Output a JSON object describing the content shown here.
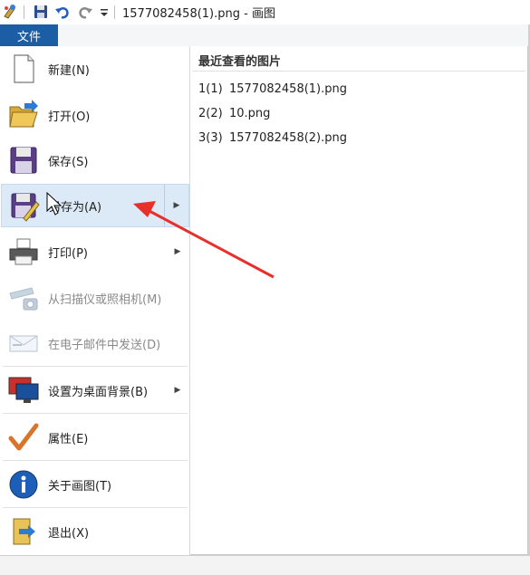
{
  "title_bar": {
    "title": "1577082458(1).png - 画图",
    "icons": [
      "paint-app-icon",
      "save-icon",
      "undo-icon",
      "redo-icon",
      "customize-quick-access-icon"
    ]
  },
  "ribbon": {
    "file_tab": "文件"
  },
  "menu": {
    "items": [
      {
        "label": "新建(N)",
        "icon": "new-document-icon",
        "enabled": true,
        "submenu": false
      },
      {
        "label": "打开(O)",
        "icon": "open-folder-icon",
        "enabled": true,
        "submenu": false
      },
      {
        "label": "保存(S)",
        "icon": "save-disk-icon",
        "enabled": true,
        "submenu": false
      },
      {
        "label": "另存为(A)",
        "icon": "save-as-icon",
        "enabled": true,
        "submenu": true,
        "hovered": true
      },
      {
        "label": "打印(P)",
        "icon": "printer-icon",
        "enabled": true,
        "submenu": true
      },
      {
        "label": "从扫描仪或照相机(M)",
        "icon": "scanner-camera-icon",
        "enabled": false,
        "submenu": false
      },
      {
        "label": "在电子邮件中发送(D)",
        "icon": "email-icon",
        "enabled": false,
        "submenu": false
      },
      {
        "label": "设置为桌面背景(B)",
        "icon": "desktop-background-icon",
        "enabled": true,
        "submenu": true
      },
      {
        "label": "属性(E)",
        "icon": "properties-check-icon",
        "enabled": true,
        "submenu": false
      },
      {
        "label": "关于画图(T)",
        "icon": "about-info-icon",
        "enabled": true,
        "submenu": false
      },
      {
        "label": "退出(X)",
        "icon": "exit-icon",
        "enabled": true,
        "submenu": false
      }
    ]
  },
  "recent": {
    "heading": "最近查看的图片",
    "files": [
      {
        "num": "1(1)",
        "name": "1577082458(1).png"
      },
      {
        "num": "2(2)",
        "name": "10.png"
      },
      {
        "num": "3(3)",
        "name": "1577082458(2).png"
      }
    ]
  },
  "colors": {
    "file_tab_bg": "#1c5ea6",
    "hover_bg": "#dce9f7",
    "annotation_arrow": "#e8302a"
  }
}
